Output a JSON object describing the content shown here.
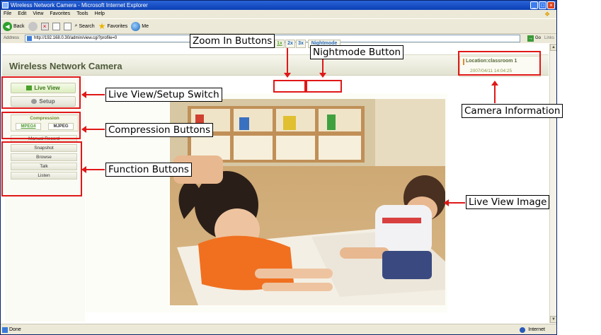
{
  "window": {
    "title": "Wireless Network Camera - Microsoft Internet Explorer",
    "controls": [
      "_",
      "□",
      "×"
    ]
  },
  "menu": [
    "File",
    "Edit",
    "View",
    "Favorites",
    "Tools",
    "Help"
  ],
  "toolbar": {
    "back": "Back",
    "search": "Search",
    "favorites": "Favorites",
    "media": "Me"
  },
  "address": {
    "label": "Address",
    "url": "http://192.168.0.30/admin/view.cgi?profile=0",
    "go": "Go",
    "links": "Links"
  },
  "page": {
    "title": "Wireless Network Camera",
    "location": "Location:classroom 1",
    "datetime": "2007/04/11 14:04:25",
    "nav": {
      "live_view": "Live View",
      "setup": "Setup"
    },
    "compression": {
      "label": "Compression",
      "mpeg4": "MPEG4",
      "mjpeg": "MJPEG"
    },
    "functions": [
      "Manual Record",
      "Snapshot",
      "Browse",
      "Talk",
      "Listen"
    ],
    "zoom": [
      "1x",
      "2x",
      "3x"
    ],
    "nightmode": "Nightmode"
  },
  "status": {
    "text": "Done",
    "zone": "Internet"
  },
  "callouts": {
    "zoom": "Zoom In Buttons",
    "nightmode": "Nightmode Button",
    "camera_info": "Camera Information",
    "live_setup": "Live View/Setup Switch",
    "compression": "Compression Buttons",
    "function": "Function Buttons",
    "live_image": "Live View Image"
  },
  "colors": {
    "annotation_red": "#e01818",
    "brand_green": "#4aa02a",
    "title_olive": "#4e5b3a"
  }
}
